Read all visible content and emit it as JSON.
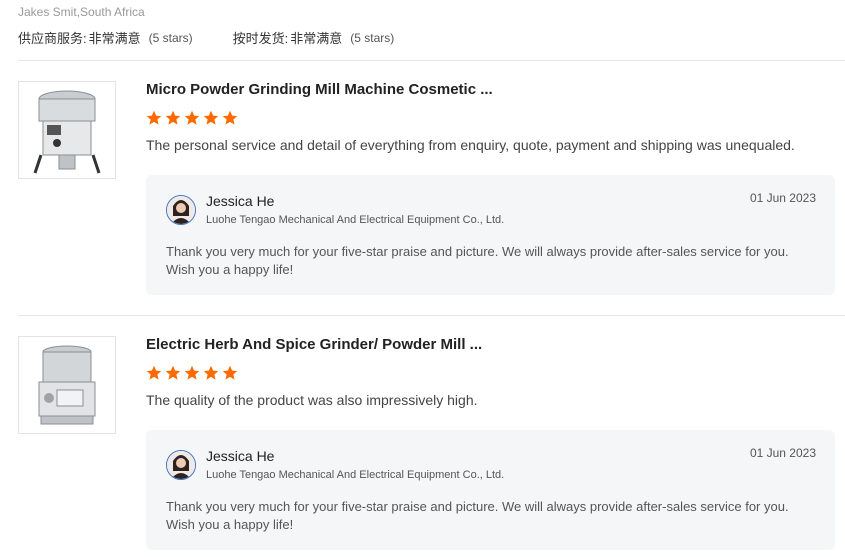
{
  "reviewer": {
    "name_location": "Jakes Smit,South Africa"
  },
  "ratings": [
    {
      "label": "供应商服务:",
      "value": "非常满意",
      "stars_text": "(5 stars)"
    },
    {
      "label": "按时发货:",
      "value": "非常满意",
      "stars_text": "(5 stars)"
    }
  ],
  "colors": {
    "star": "#ff6a00",
    "reply_bg": "#f5f6f7",
    "divider": "#e6e6e6"
  },
  "reviews": [
    {
      "product_title": "Micro Powder Grinding Mill Machine Cosmetic ...",
      "rating_stars": 5,
      "text": "The personal service and detail of everything from enquiry, quote, payment and shipping was unequaled.",
      "reply": {
        "name": "Jessica He",
        "company": "Luohe Tengao Mechanical And Electrical Equipment Co., Ltd.",
        "date": "01 Jun 2023",
        "text": "Thank you very much for your five-star praise and picture.  We will always provide after-sales service for you. Wish you a happy life!"
      }
    },
    {
      "product_title": "Electric Herb And Spice Grinder/ Powder Mill ...",
      "rating_stars": 5,
      "text": "The quality of the product was also impressively high.",
      "reply": {
        "name": "Jessica He",
        "company": "Luohe Tengao Mechanical And Electrical Equipment Co., Ltd.",
        "date": "01 Jun 2023",
        "text": "Thank you very much for your five-star praise and picture.  We will always provide after-sales service for you. Wish you a happy life!"
      }
    }
  ]
}
